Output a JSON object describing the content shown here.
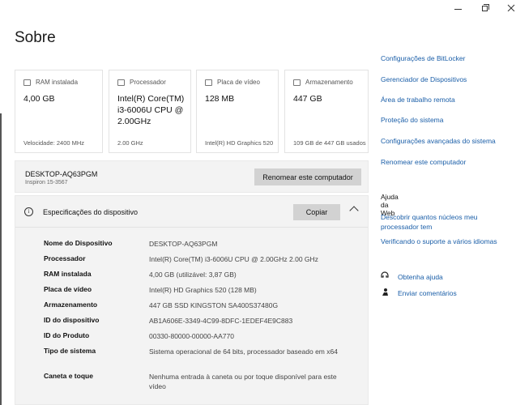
{
  "page": {
    "title": "Sobre"
  },
  "cards": [
    {
      "label": "RAM instalada",
      "value": "4,00 GB",
      "sub": "Velocidade: 2400 MHz",
      "icon": "ram-icon"
    },
    {
      "label": "Processador",
      "value": "Intel(R) Core(TM) i3-6006U CPU @ 2.00GHz",
      "sub": "2.00 GHz",
      "icon": "processor-icon"
    },
    {
      "label": "Placa de vídeo",
      "value": "128 MB",
      "sub": "Intel(R) HD Graphics 520",
      "icon": "gpu-icon"
    },
    {
      "label": "Armazenamento",
      "value": "447 GB",
      "sub": "109 GB de 447 GB usados",
      "icon": "storage-icon"
    }
  ],
  "device": {
    "name": "DESKTOP-AQ63PGM",
    "model": "Inspiron 15-3567",
    "rename_label": "Renomear este computador"
  },
  "specs": {
    "title": "Especificações do dispositivo",
    "copy_label": "Copiar",
    "rows": [
      {
        "key": "Nome do Dispositivo",
        "value": "DESKTOP-AQ63PGM"
      },
      {
        "key": "Processador",
        "value": "Intel(R) Core(TM) i3-6006U CPU @ 2.00GHz   2.00 GHz"
      },
      {
        "key": "RAM instalada",
        "value": "4,00 GB (utilizável: 3,87 GB)"
      },
      {
        "key": "Placa de vídeo",
        "value": "Intel(R) HD Graphics 520 (128 MB)"
      },
      {
        "key": "Armazenamento",
        "value": "447 GB SSD KINGSTON SA400S37480G"
      },
      {
        "key": "ID do dispositivo",
        "value": "AB1A606E-3349-4C99-8DFC-1EDEF4E9C883"
      },
      {
        "key": "ID do Produto",
        "value": "00330-80000-00000-AA770"
      },
      {
        "key": "Tipo de sistema",
        "value": "Sistema operacional de 64 bits, processador baseado em x64"
      },
      {
        "key": "Caneta e toque",
        "value": "Nenhuma entrada à caneta ou por toque disponível para este vídeo"
      }
    ]
  },
  "side": {
    "links": [
      "Configurações de BitLocker",
      "Gerenciador de Dispositivos",
      "Área de trabalho remota",
      "Proteção do sistema",
      "Configurações avançadas do sistema",
      "Renomear este computador"
    ],
    "web_heading": "Ajuda da Web",
    "web_links": [
      "Descobrir quantos núcleos meu processador tem",
      "Verificando o suporte a vários idiomas"
    ],
    "help_label": "Obtenha ajuda",
    "feedback_label": "Enviar comentários"
  },
  "colors": {
    "link": "#1a5ea8",
    "panel": "#f3f3f3",
    "button": "#d2d2d2"
  }
}
